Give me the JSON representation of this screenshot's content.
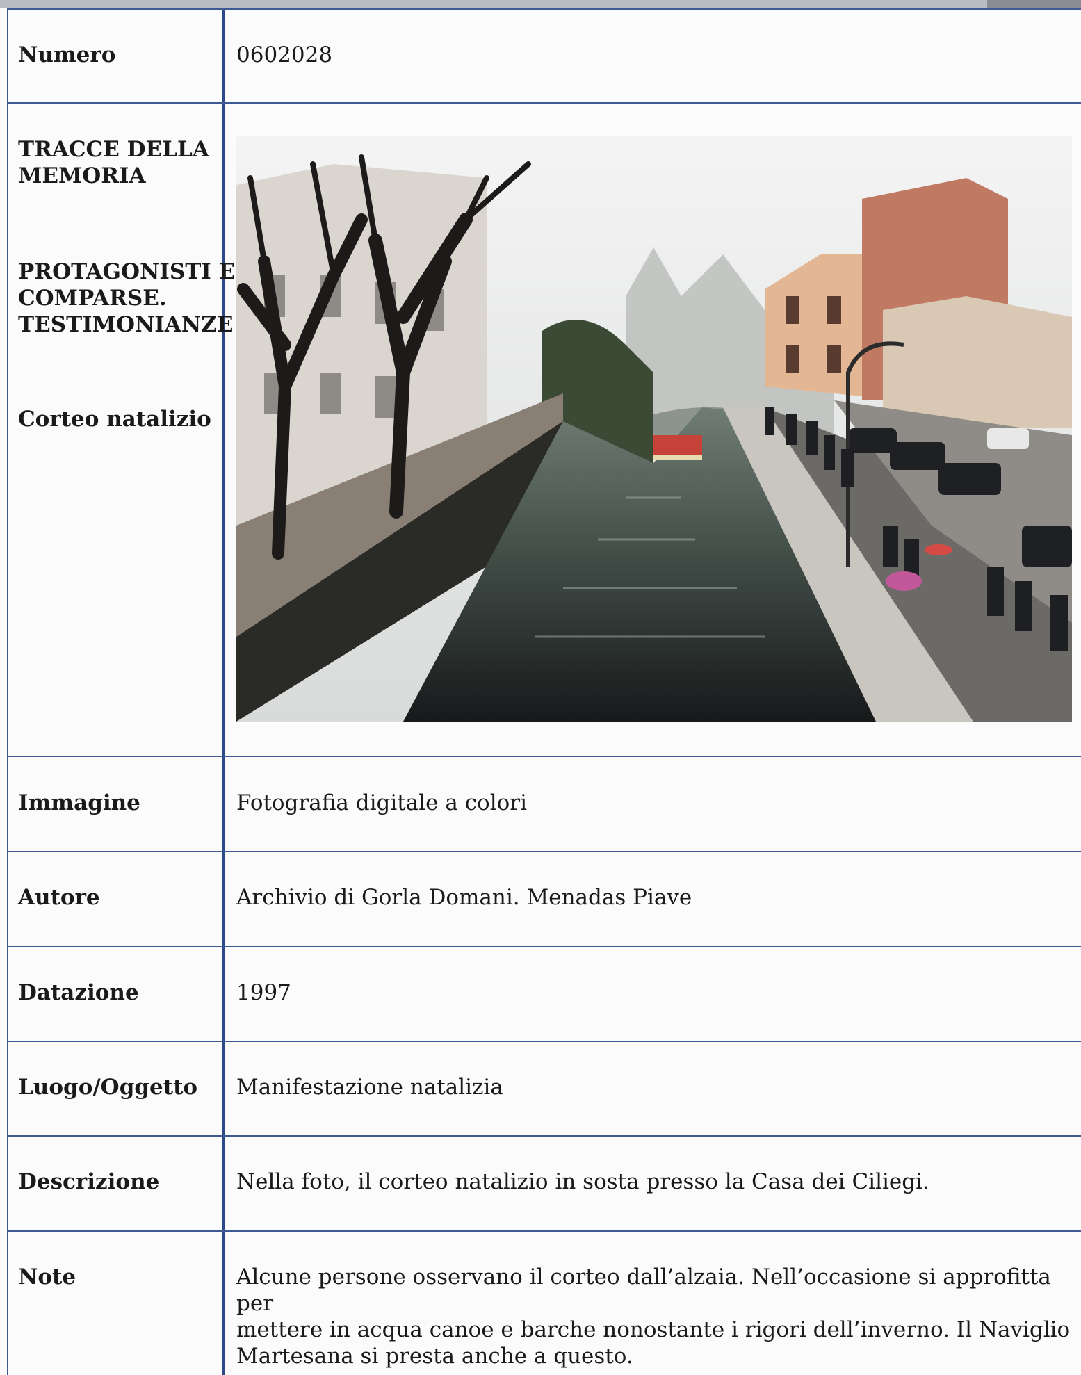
{
  "numero": {
    "label": "Numero",
    "value": "0602028"
  },
  "section": {
    "heading": "TRACCE DELLA\nMEMORIA",
    "subheading": "PROTAGONISTI E\nCOMPARSE.\nTESTIMONIANZE",
    "title": "Corteo natalizio"
  },
  "photo": {
    "icon": "canal-photo"
  },
  "immagine": {
    "label": "Immagine",
    "value": "Fotografia digitale a colori"
  },
  "autore": {
    "label": "Autore",
    "value": "Archivio di Gorla Domani. Menadas Piave"
  },
  "datazione": {
    "label": "Datazione",
    "value": "1997"
  },
  "luogo": {
    "label": "Luogo/Oggetto",
    "value": "Manifestazione natalizia"
  },
  "descrizione": {
    "label": "Descrizione",
    "value": "Nella foto, il corteo natalizio in sosta presso la Casa dei Ciliegi."
  },
  "note": {
    "label": "Note",
    "value": "Alcune persone osservano il corteo dall’alzaia. Nell’occasione si approfitta per\nmettere in acqua canoe e barche nonostante i rigori dell’inverno. Il Naviglio\nMartesana si presta anche a questo."
  },
  "colors": {
    "grid": "#3f5a93",
    "divider": "#2c4a8a"
  }
}
